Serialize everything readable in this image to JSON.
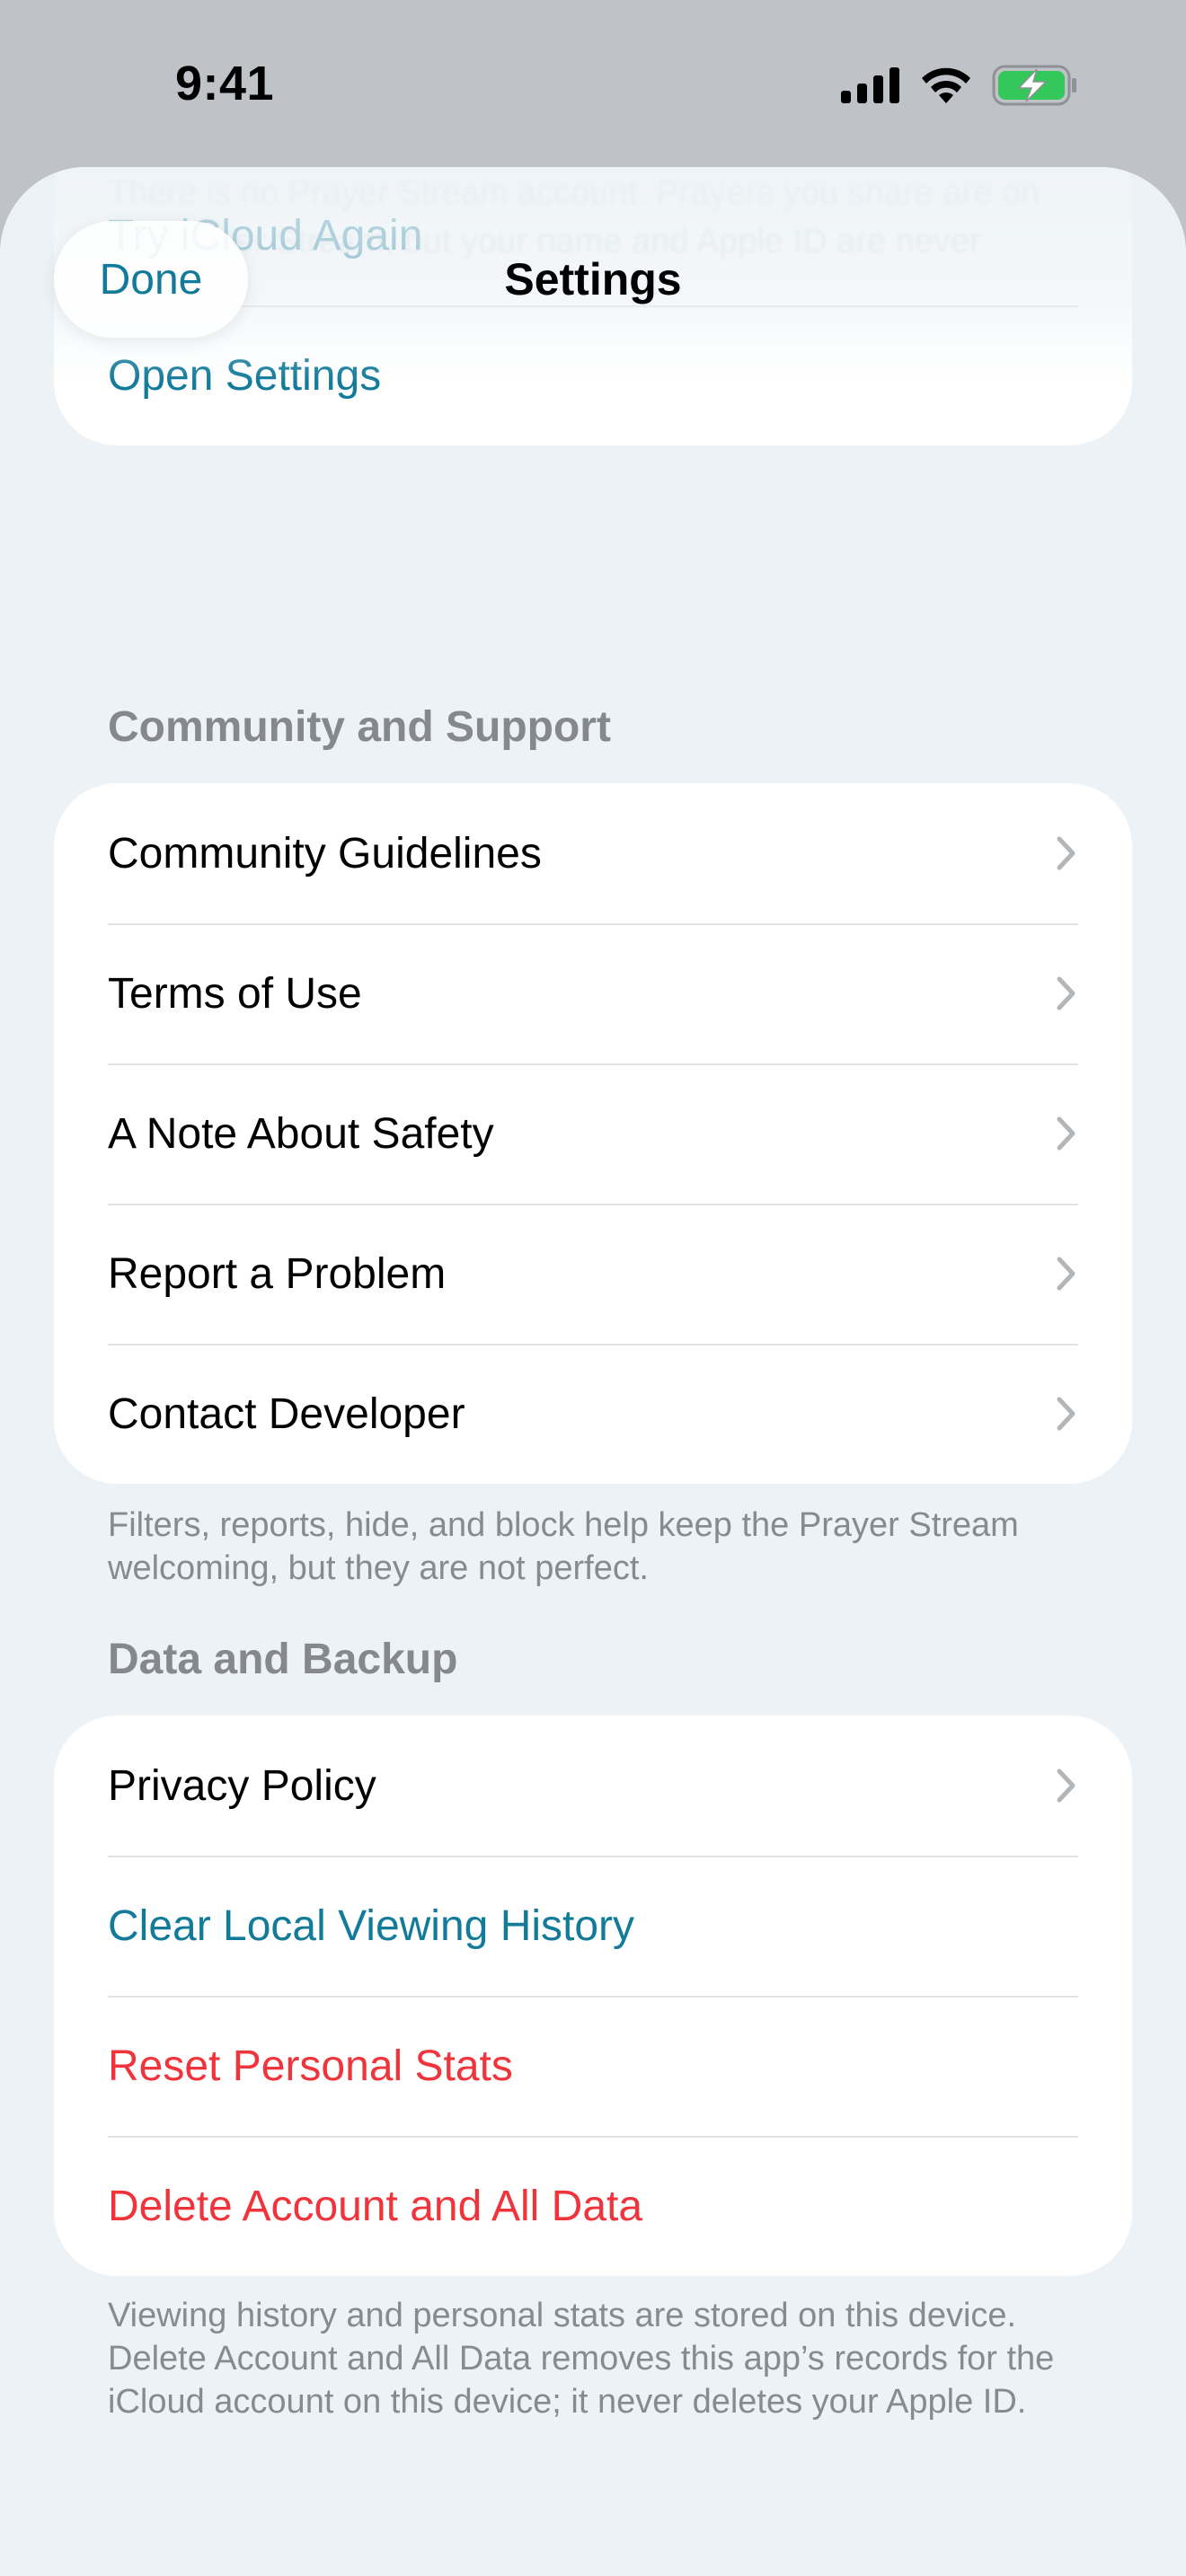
{
  "status_bar": {
    "time": "9:41"
  },
  "header": {
    "title": "Settings",
    "done_label": "Done",
    "ghost_text": "There is no Prayer Stream account. Prayers you share are on the Prayer Stream, but your name and Apple ID are never shown."
  },
  "icloud_card": {
    "items": [
      {
        "label": "Try iCloud Again"
      },
      {
        "label": "Open Settings"
      }
    ]
  },
  "community": {
    "header": "Community and Support",
    "items": [
      {
        "label": "Community Guidelines"
      },
      {
        "label": "Terms of Use"
      },
      {
        "label": "A Note About Safety"
      },
      {
        "label": "Report a Problem"
      },
      {
        "label": "Contact Developer"
      }
    ],
    "footer": "Filters, reports, hide, and block help keep the Prayer Stream welcoming, but they are not perfect."
  },
  "data_backup": {
    "header": "Data and Backup",
    "items": [
      {
        "label": "Privacy Policy"
      },
      {
        "label": "Clear Local Viewing History"
      },
      {
        "label": "Reset Personal Stats"
      },
      {
        "label": "Delete Account and All Data"
      }
    ],
    "footer": "Viewing history and personal stats are stored on this device. Delete Account and All Data removes this app’s records for the iCloud account on this device; it never deletes your Apple ID."
  },
  "colors": {
    "accent": "#137b9a",
    "destructive": "#f0343b",
    "battery": "#34c759",
    "background": "#ecf2f6"
  }
}
